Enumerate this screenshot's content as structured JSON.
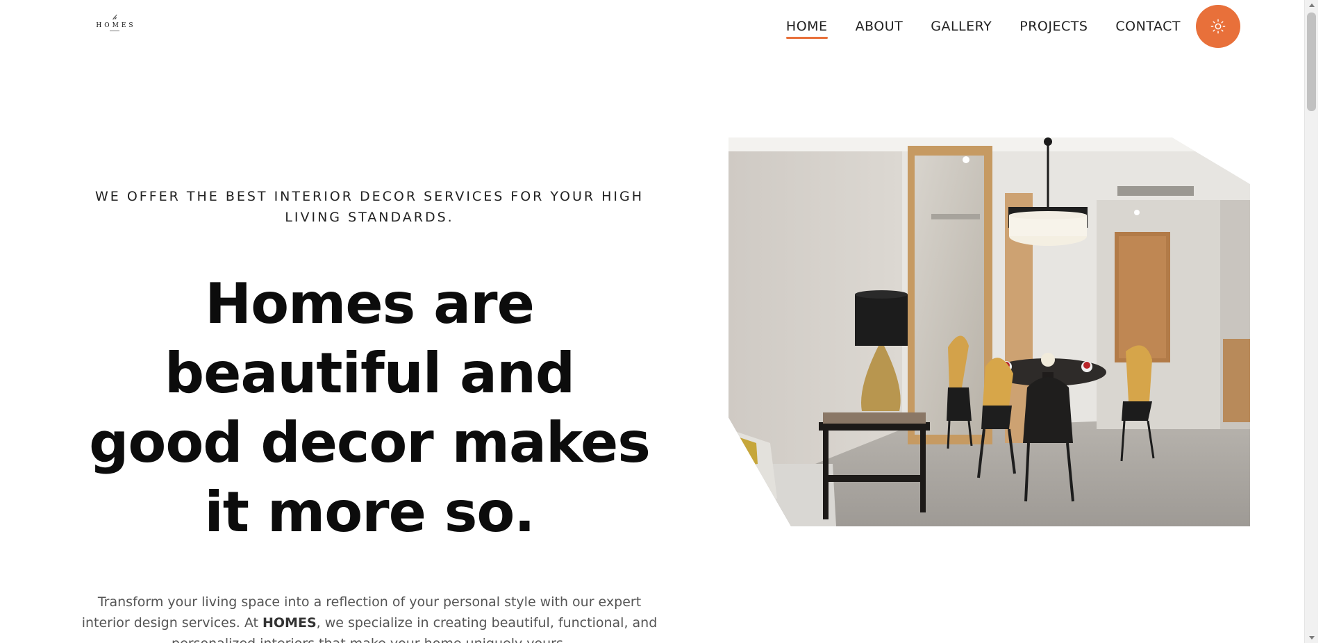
{
  "brand": {
    "logo_word": "HOMES",
    "accent_color": "#e8703a"
  },
  "nav": {
    "items": [
      {
        "label": "HOME",
        "active": true
      },
      {
        "label": "ABOUT",
        "active": false
      },
      {
        "label": "GALLERY",
        "active": false
      },
      {
        "label": "PROJECTS",
        "active": false
      },
      {
        "label": "CONTACT",
        "active": false
      }
    ],
    "theme_toggle_icon": "sun-icon"
  },
  "hero": {
    "tagline": "WE OFFER THE BEST INTERIOR DECOR SERVICES FOR YOUR HIGH LIVING STANDARDS.",
    "headline": "Homes are beautiful and good decor makes it more so.",
    "intro_before": "Transform your living space into a reflection of your personal style with our expert interior design services. At ",
    "intro_brand": "HOMES",
    "intro_after": ", we specialize in creating beautiful, functional, and personalized interiors that make your home uniquely yours."
  }
}
